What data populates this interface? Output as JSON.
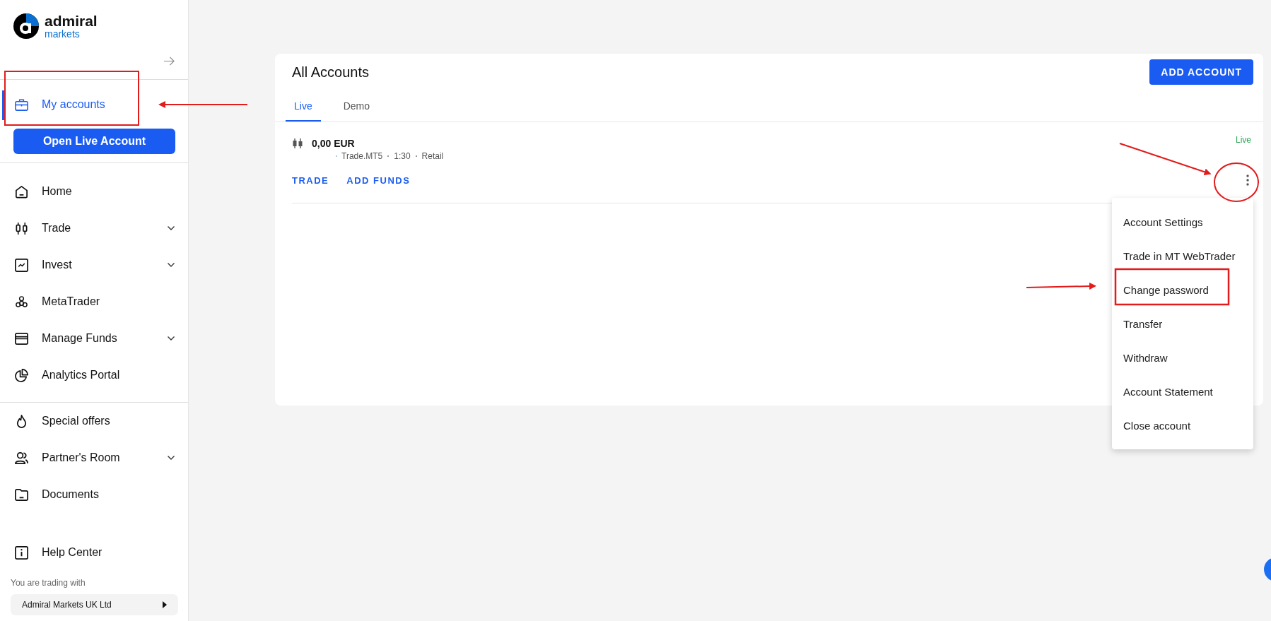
{
  "brand": {
    "name": "admiral",
    "sub": "markets"
  },
  "sidebar": {
    "account_item": {
      "label": "My accounts",
      "selected": true
    },
    "open_button": "Open Live Account",
    "items": [
      {
        "label": "Home",
        "expandable": false,
        "selected": false
      },
      {
        "label": "Trade",
        "expandable": true,
        "selected": false
      },
      {
        "label": "Invest",
        "expandable": true,
        "selected": false
      },
      {
        "label": "MetaTrader",
        "expandable": false,
        "selected": false
      },
      {
        "label": "Manage Funds",
        "expandable": true,
        "selected": false
      },
      {
        "label": "Analytics Portal",
        "expandable": false,
        "selected": false
      }
    ],
    "items_2": [
      {
        "label": "Special offers",
        "expandable": false,
        "selected": false
      },
      {
        "label": "Partner's Room",
        "expandable": true,
        "selected": false
      },
      {
        "label": "Documents",
        "expandable": false,
        "selected": false
      }
    ],
    "help": {
      "label": "Help Center"
    },
    "trading_with": "You are trading with",
    "entity": "Admiral Markets UK Ltd"
  },
  "accounts": {
    "title": "All Accounts",
    "add_button": "ADD ACCOUNT",
    "tabs": [
      {
        "label": "Live",
        "selected": true
      },
      {
        "label": "Demo",
        "selected": false
      }
    ],
    "account": {
      "balance": "0,00 EUR",
      "platform": "Trade.MT5",
      "leverage": "1:30",
      "type": "Retail",
      "status": "Live",
      "actions": [
        "TRADE",
        "ADD FUNDS"
      ]
    },
    "menu": [
      "Account Settings",
      "Trade in MT WebTrader",
      "Change password",
      "Transfer",
      "Withdraw",
      "Account Statement",
      "Close account"
    ]
  }
}
